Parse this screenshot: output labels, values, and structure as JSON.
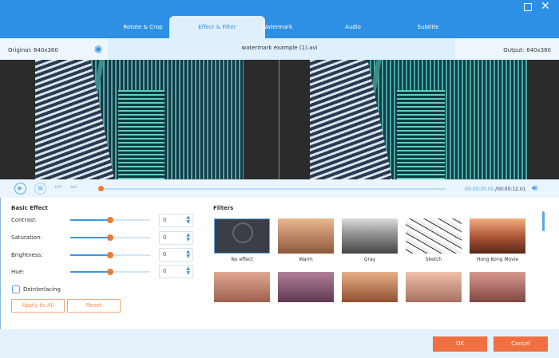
{
  "window": {
    "maximize_icon": "square-icon",
    "close_icon": "x-icon"
  },
  "tabs": [
    {
      "label": "Rotate & Crop"
    },
    {
      "label": "Effect & Filter",
      "active": true
    },
    {
      "label": "Watermark"
    },
    {
      "label": "Audio"
    },
    {
      "label": "Subtitle"
    }
  ],
  "info": {
    "original": "Original: 640x360",
    "filename": "watermark example (1).avi",
    "output": "Output: 640x360"
  },
  "player": {
    "current_time": "00:00:00.00",
    "total_time": "/00:00:12.01",
    "progress": 0
  },
  "basic_effect": {
    "title": "Basic Effect",
    "controls": [
      {
        "label": "Contrast:",
        "value": "0"
      },
      {
        "label": "Saturation:",
        "value": "0"
      },
      {
        "label": "Brightness:",
        "value": "0"
      },
      {
        "label": "Hue:",
        "value": "0"
      }
    ],
    "deinterlacing": "Deinterlacing",
    "deinterlacing_checked": false,
    "apply_all": "Apply to All",
    "reset": "Reset"
  },
  "filters": {
    "title": "Filters",
    "items": [
      {
        "label": "No effect"
      },
      {
        "label": "Warm"
      },
      {
        "label": "Gray"
      },
      {
        "label": "Sketch"
      },
      {
        "label": "Hong Kong Movie"
      }
    ]
  },
  "footer": {
    "ok": "OK",
    "cancel": "Cancel"
  },
  "colors": {
    "accent": "#2e90e5",
    "orange": "#f07042"
  }
}
